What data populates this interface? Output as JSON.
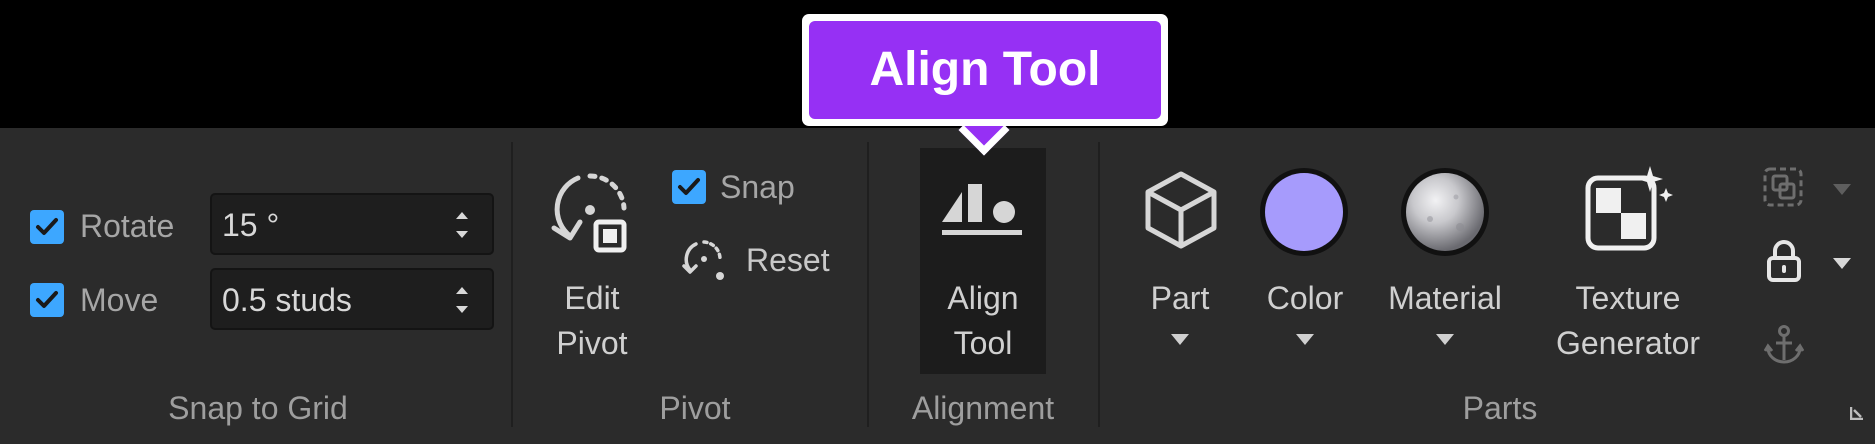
{
  "tooltip": {
    "text": "Align Tool",
    "color": "#9630f4"
  },
  "snap_to_grid": {
    "group_label": "Snap to Grid",
    "rotate": {
      "label": "Rotate",
      "checked": true,
      "value": "15 °"
    },
    "move": {
      "label": "Move",
      "checked": true,
      "value": "0.5 studs"
    }
  },
  "pivot": {
    "group_label": "Pivot",
    "edit_pivot_line1": "Edit",
    "edit_pivot_line2": "Pivot",
    "snap": {
      "label": "Snap",
      "checked": true
    },
    "reset_label": "Reset"
  },
  "alignment": {
    "group_label": "Alignment",
    "align_tool_line1": "Align",
    "align_tool_line2": "Tool"
  },
  "parts": {
    "group_label": "Parts",
    "part_label": "Part",
    "color_label": "Color",
    "material_label": "Material",
    "texture_line1": "Texture",
    "texture_line2": "Generator",
    "color_swatch": "#a69bfc"
  },
  "icons": [
    "checkbox-icon",
    "spin-arrows-icon",
    "edit-pivot-icon",
    "reset-pivot-icon",
    "align-icon",
    "part-cube-icon",
    "color-swatch-icon",
    "material-sphere-icon",
    "texture-generator-icon",
    "group-icon",
    "lock-icon",
    "anchor-icon",
    "dropdown-arrow-icon",
    "expand-corner-icon"
  ]
}
